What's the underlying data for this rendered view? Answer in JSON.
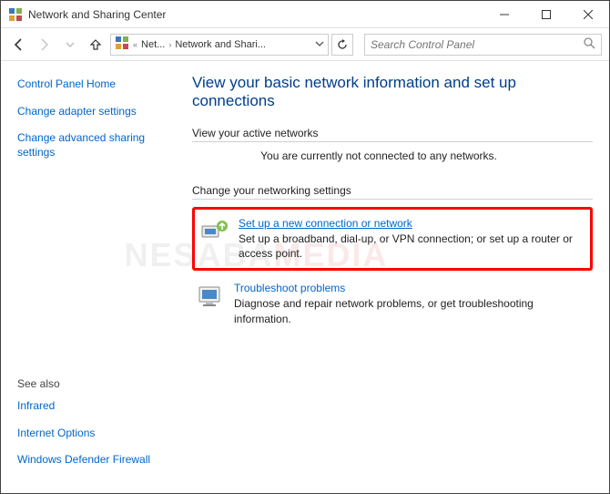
{
  "window": {
    "title": "Network and Sharing Center"
  },
  "nav": {
    "crumb1": "Net...",
    "crumb2": "Network and Shari...",
    "search_placeholder": "Search Control Panel"
  },
  "sidebar": {
    "home": "Control Panel Home",
    "adapter": "Change adapter settings",
    "advanced": "Change advanced sharing settings",
    "seealso": "See also",
    "infrared": "Infrared",
    "inetopt": "Internet Options",
    "firewall": "Windows Defender Firewall"
  },
  "main": {
    "title": "View your basic network information and set up connections",
    "active_label": "View your active networks",
    "not_connected": "You are currently not connected to any networks.",
    "change_label": "Change your networking settings",
    "setup_link": "Set up a new connection or network",
    "setup_desc": "Set up a broadband, dial-up, or VPN connection; or set up a router or access point.",
    "trouble_link": "Troubleshoot problems",
    "trouble_desc": "Diagnose and repair network problems, or get troubleshooting information."
  },
  "watermark": {
    "a": "NESABA",
    "b": "MEDIA"
  }
}
